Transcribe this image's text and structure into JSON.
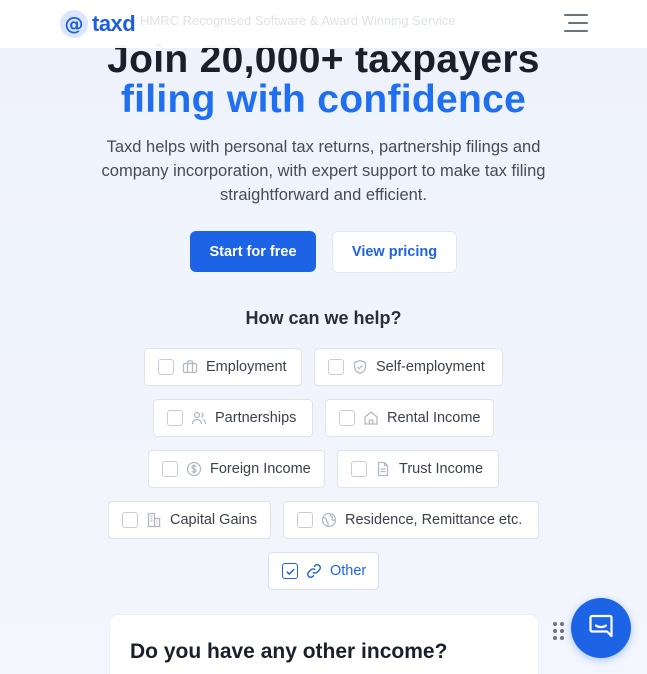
{
  "header": {
    "logo_symbol": "@",
    "logo_text": "taxd",
    "tagline": "HMRC Recognised Software & Award Winning Service",
    "menu_icon": "hamburger-menu-icon"
  },
  "hero": {
    "line1": "Join 20,000+ taxpayers",
    "line2": "filing with confidence",
    "subtitle": "Taxd helps with personal tax returns, partnership filings and company incorporation, with expert support to make tax filing straightforward and efficient.",
    "primary_cta": "Start for free",
    "secondary_cta": "View pricing"
  },
  "help": {
    "title": "How can we help?",
    "options": [
      {
        "label": "Employment",
        "icon": "briefcase-icon",
        "checked": false
      },
      {
        "label": "Self-employment",
        "icon": "shield-icon",
        "checked": false
      },
      {
        "label": "Partnerships",
        "icon": "users-icon",
        "checked": false
      },
      {
        "label": "Rental Income",
        "icon": "home-icon",
        "checked": false
      },
      {
        "label": "Foreign Income",
        "icon": "currency-icon",
        "checked": false
      },
      {
        "label": "Trust Income",
        "icon": "document-icon",
        "checked": false
      },
      {
        "label": "Capital Gains",
        "icon": "building-icon",
        "checked": false
      },
      {
        "label": "Residence, Remittance etc.",
        "icon": "globe-icon",
        "checked": false
      },
      {
        "label": "Other",
        "icon": "link-icon",
        "checked": true
      }
    ]
  },
  "question_card": {
    "title": "Do you have any other income?"
  },
  "chat": {
    "icon": "chat-bubble-icon"
  },
  "colors": {
    "brand": "#1d63e6",
    "accent_text": "#1f6ff0",
    "heading": "#1a1f2b"
  }
}
